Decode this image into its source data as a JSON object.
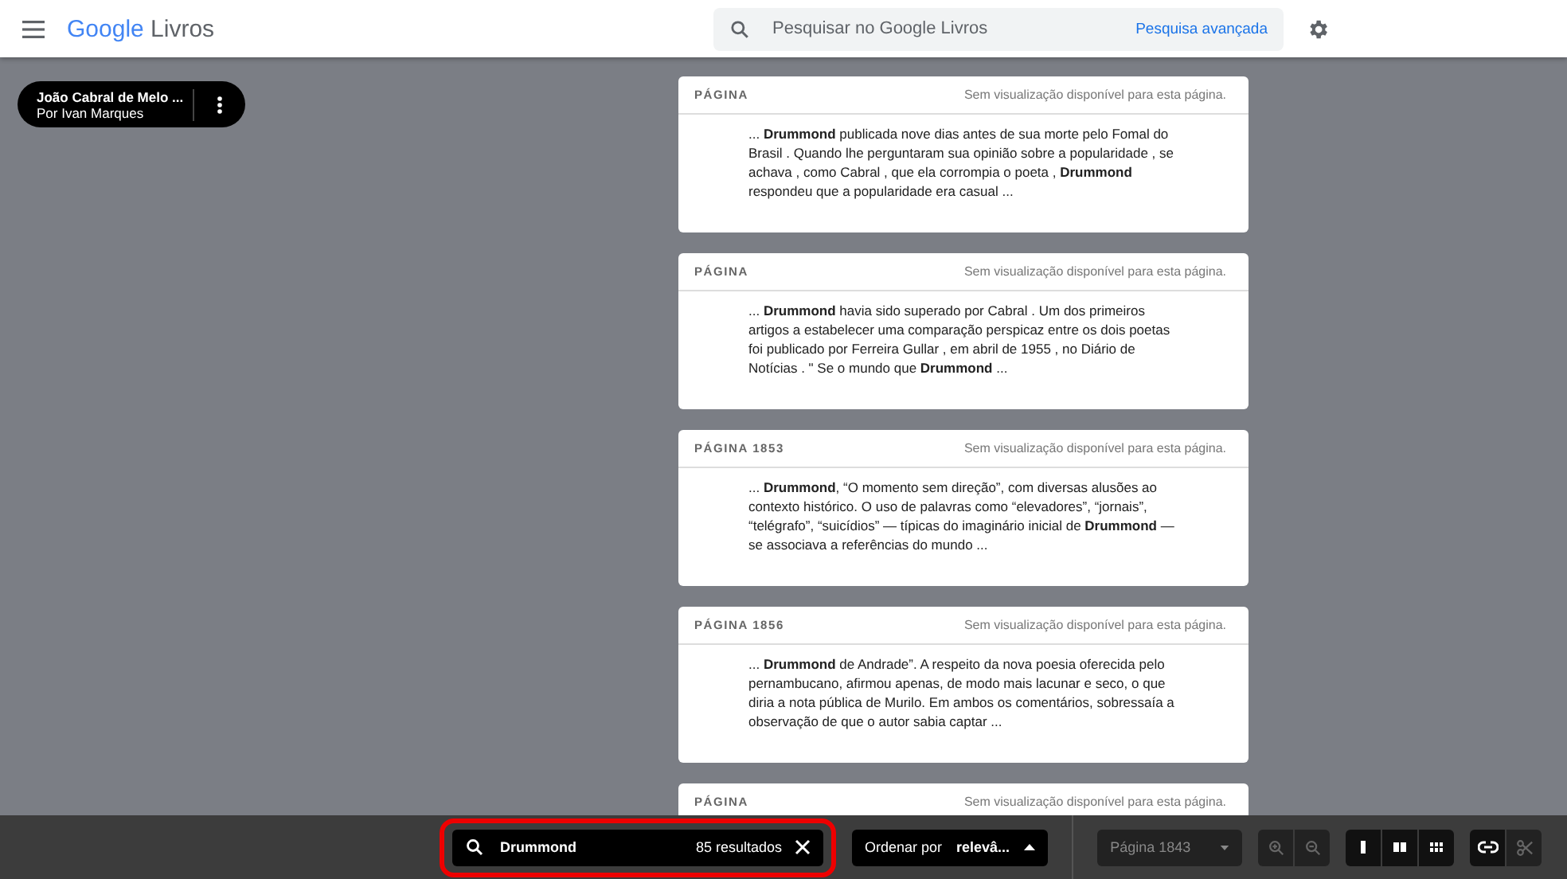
{
  "header": {
    "logo_brand": "Google",
    "logo_product": "Livros",
    "search": {
      "placeholder": "Pesquisar no Google Livros"
    },
    "advanced_link": "Pesquisa avançada"
  },
  "book_chip": {
    "title": "João Cabral de Melo ...",
    "author": "Por Ivan Marques"
  },
  "results": [
    {
      "page": "PÁGINA",
      "note": "Sem visualização disponível para esta página.",
      "snippet": "... **Drummond** publicada nove dias antes de sua morte pelo Fomal do Brasil . Quando lhe perguntaram sua opinião sobre a popularidade , se achava , como Cabral , que ela corrompia o poeta , **Drummond** respondeu que a popularidade era casual ..."
    },
    {
      "page": "PÁGINA",
      "note": "Sem visualização disponível para esta página.",
      "snippet": "... **Drummond** havia sido superado por Cabral . Um dos primeiros artigos a estabelecer uma comparação perspicaz entre os dois poetas foi publicado por Ferreira Gullar , em abril de 1955 , no Diário de Notícias . \" Se o mundo que **Drummond** ..."
    },
    {
      "page": "PÁGINA 1853",
      "note": "Sem visualização disponível para esta página.",
      "snippet": "... **Drummond**, “O momento sem direção”, com diversas alusões ao contexto histórico. O uso de palavras como “elevadores”, “jornais”, “telégrafo”, “suicídios” — típicas do imaginário inicial de **Drummond** — se associava a referências do mundo ..."
    },
    {
      "page": "PÁGINA 1856",
      "note": "Sem visualização disponível para esta página.",
      "snippet": "... **Drummond** de Andrade”. A respeito da nova poesia oferecida pelo pernambucano, afirmou apenas, de modo mais lacunar e seco, o que diria a nota pública de Murilo. Em ambos os comentários, sobressaía a observação de que o autor sabia captar ..."
    },
    {
      "page": "PÁGINA",
      "note": "Sem visualização disponível para esta página."
    }
  ],
  "bottom_bar": {
    "search": {
      "value": "Drummond",
      "count": "85 resultados",
      "highlighted": true
    },
    "sort": {
      "prefix": "Ordenar por ",
      "value": "relevâ..."
    },
    "page_select": {
      "value": "Página 1843",
      "disabled": true
    },
    "tools": [
      {
        "kind": "zoom-in",
        "disabled": true
      },
      {
        "kind": "zoom-out",
        "disabled": true
      },
      {
        "kind": "single",
        "disabled": false
      },
      {
        "kind": "double",
        "disabled": false
      },
      {
        "kind": "grid",
        "disabled": false
      },
      {
        "kind": "link",
        "disabled": false
      },
      {
        "kind": "clip",
        "disabled": true
      }
    ]
  }
}
